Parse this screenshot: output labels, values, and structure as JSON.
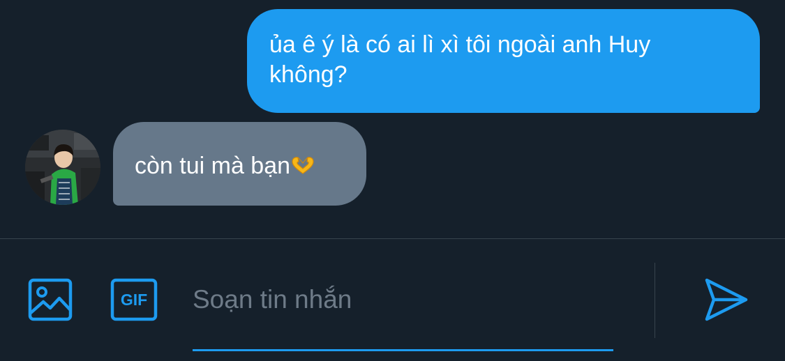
{
  "conversation": {
    "messages": [
      {
        "direction": "outgoing",
        "lines": [
          "ủa ê ý là có ai lì xì tôi ngoài anh Huy",
          "không?"
        ]
      },
      {
        "direction": "incoming",
        "text": "còn tui mà bạn",
        "emoji": "heart-hands-emoji"
      }
    ]
  },
  "composer": {
    "placeholder": "Soạn tin nhắn",
    "value": "",
    "gif_label": "GIF",
    "icons": [
      "image-icon",
      "gif-icon",
      "send-icon"
    ]
  },
  "colors": {
    "background": "#15202b",
    "outgoing_bubble": "#1d9bf0",
    "incoming_bubble": "#66788a",
    "accent": "#1d9bf0",
    "placeholder": "#6e7b88",
    "divider": "#38444d"
  }
}
